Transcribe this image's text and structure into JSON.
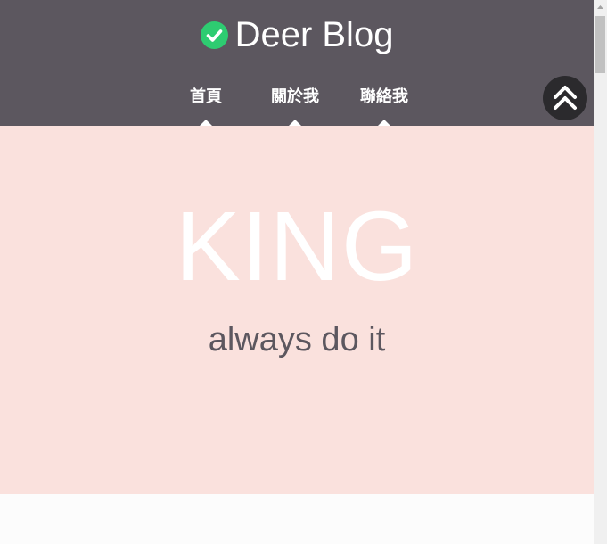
{
  "brand": {
    "title": "Deer Blog",
    "icon": "check-circle-icon",
    "icon_color": "#2ecc71"
  },
  "nav": {
    "items": [
      {
        "label": "首頁"
      },
      {
        "label": "關於我"
      },
      {
        "label": "聯絡我"
      }
    ]
  },
  "back_to_top": {
    "icon": "double-chevron-up-icon"
  },
  "hero": {
    "title": "KING",
    "subtitle": "always do it"
  },
  "colors": {
    "header_bg": "#5c575f",
    "hero_bg": "#fae1dd",
    "hero_title": "#ffffff",
    "hero_subtitle": "#5c575f",
    "back_to_top_bg": "#2b2a2d"
  }
}
